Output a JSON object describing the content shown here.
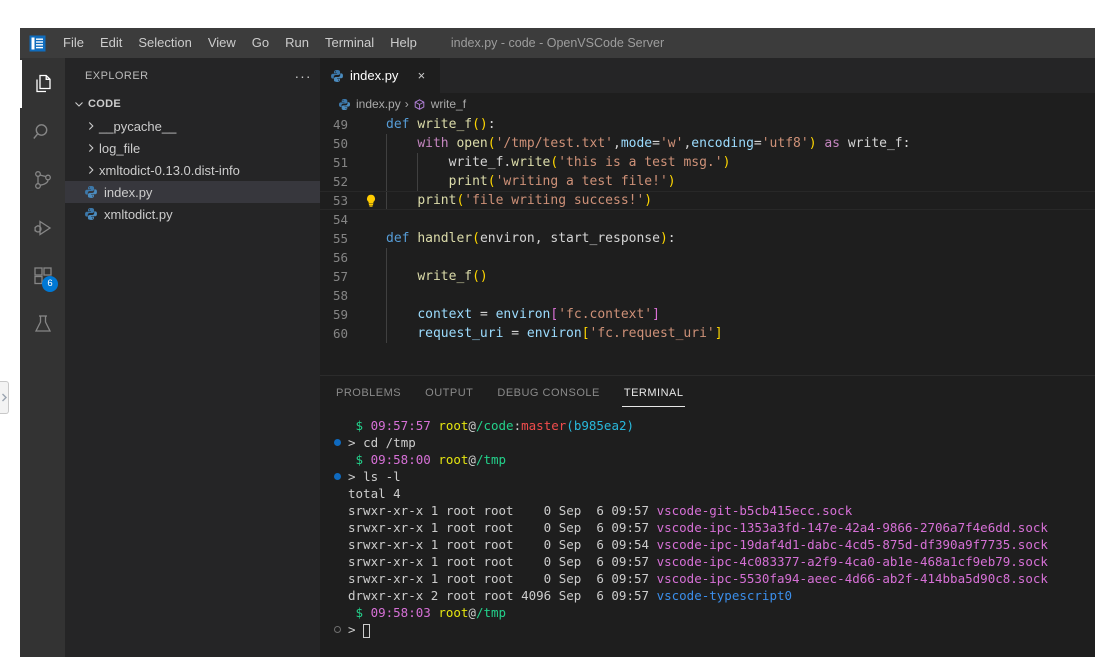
{
  "window": {
    "title": "index.py - code - OpenVSCode Server",
    "logo_icon": "vscode-logo-icon"
  },
  "menubar": {
    "items": [
      {
        "label": "File",
        "name": "menu-file"
      },
      {
        "label": "Edit",
        "name": "menu-edit"
      },
      {
        "label": "Selection",
        "name": "menu-selection"
      },
      {
        "label": "View",
        "name": "menu-view"
      },
      {
        "label": "Go",
        "name": "menu-go"
      },
      {
        "label": "Run",
        "name": "menu-run"
      },
      {
        "label": "Terminal",
        "name": "menu-terminal"
      },
      {
        "label": "Help",
        "name": "menu-help"
      }
    ]
  },
  "activitybar": {
    "items": [
      {
        "icon": "files-explorer-icon",
        "name": "activity-explorer",
        "active": true,
        "badge": ""
      },
      {
        "icon": "search-icon",
        "name": "activity-search",
        "active": false,
        "badge": ""
      },
      {
        "icon": "source-control-icon",
        "name": "activity-source-control",
        "active": false,
        "badge": ""
      },
      {
        "icon": "run-and-debug-icon",
        "name": "activity-run-debug",
        "active": false,
        "badge": ""
      },
      {
        "icon": "extensions-icon",
        "name": "activity-extensions",
        "active": false,
        "badge": "6"
      },
      {
        "icon": "testing-flask-icon",
        "name": "activity-testing",
        "active": false,
        "badge": ""
      }
    ],
    "badge_color": "#0078d4"
  },
  "sidebar": {
    "header_title": "EXPLORER",
    "more_actions": "···",
    "section_title": "CODE",
    "items": [
      {
        "label": "__pycache__",
        "type": "folder",
        "selected": false
      },
      {
        "label": "log_file",
        "type": "folder",
        "selected": false
      },
      {
        "label": "xmltodict-0.13.0.dist-info",
        "type": "folder",
        "selected": false
      },
      {
        "label": "index.py",
        "type": "python-file",
        "selected": true
      },
      {
        "label": "xmltodict.py",
        "type": "python-file",
        "selected": false
      }
    ]
  },
  "editor": {
    "tab": {
      "label": "index.py",
      "icon": "python-file-icon",
      "close_icon": "×"
    },
    "breadcrumb": {
      "file": "index.py",
      "symbol": "write_f",
      "separator": "›",
      "file_icon": "python-file-icon",
      "symbol_icon": "symbol-method-icon"
    },
    "lines": [
      {
        "num": "49",
        "bulb": false,
        "indent": 0,
        "tokens": [
          {
            "t": "def ",
            "c": "tok-kw"
          },
          {
            "t": "write_f",
            "c": "tok-fn"
          },
          {
            "t": "()",
            "c": "tok-paren"
          },
          {
            "t": ":",
            "c": "tok-plain"
          }
        ]
      },
      {
        "num": "50",
        "bulb": false,
        "indent": 1,
        "tokens": [
          {
            "t": "    ",
            "c": "tok-plain"
          },
          {
            "t": "with ",
            "c": "tok-kw2"
          },
          {
            "t": "open",
            "c": "tok-fn"
          },
          {
            "t": "(",
            "c": "tok-paren"
          },
          {
            "t": "'/tmp/test.txt'",
            "c": "tok-str"
          },
          {
            "t": ",",
            "c": "tok-plain"
          },
          {
            "t": "mode",
            "c": "tok-var"
          },
          {
            "t": "=",
            "c": "tok-plain"
          },
          {
            "t": "'w'",
            "c": "tok-str"
          },
          {
            "t": ",",
            "c": "tok-plain"
          },
          {
            "t": "encoding",
            "c": "tok-var"
          },
          {
            "t": "=",
            "c": "tok-plain"
          },
          {
            "t": "'utf8'",
            "c": "tok-str"
          },
          {
            "t": ")",
            "c": "tok-paren"
          },
          {
            "t": " ",
            "c": "tok-plain"
          },
          {
            "t": "as",
            "c": "tok-kw2"
          },
          {
            "t": " write_f:",
            "c": "tok-plain"
          }
        ]
      },
      {
        "num": "51",
        "bulb": false,
        "indent": 2,
        "tokens": [
          {
            "t": "        ",
            "c": "tok-plain"
          },
          {
            "t": "write_f",
            "c": "tok-plain"
          },
          {
            "t": ".",
            "c": "tok-plain"
          },
          {
            "t": "write",
            "c": "tok-fn"
          },
          {
            "t": "(",
            "c": "tok-paren"
          },
          {
            "t": "'this is a test msg.'",
            "c": "tok-str"
          },
          {
            "t": ")",
            "c": "tok-paren"
          }
        ]
      },
      {
        "num": "52",
        "bulb": false,
        "indent": 2,
        "tokens": [
          {
            "t": "        ",
            "c": "tok-plain"
          },
          {
            "t": "print",
            "c": "tok-fn"
          },
          {
            "t": "(",
            "c": "tok-paren"
          },
          {
            "t": "'writing a test file!'",
            "c": "tok-str"
          },
          {
            "t": ")",
            "c": "tok-paren"
          }
        ]
      },
      {
        "num": "53",
        "bulb": true,
        "indent": 1,
        "current": true,
        "tokens": [
          {
            "t": "    ",
            "c": "tok-plain"
          },
          {
            "t": "print",
            "c": "tok-fn"
          },
          {
            "t": "(",
            "c": "tok-paren"
          },
          {
            "t": "'file writing success!'",
            "c": "tok-str"
          },
          {
            "t": ")",
            "c": "tok-paren"
          }
        ]
      },
      {
        "num": "54",
        "bulb": false,
        "indent": 0,
        "tokens": []
      },
      {
        "num": "55",
        "bulb": false,
        "indent": 0,
        "tokens": [
          {
            "t": "def ",
            "c": "tok-kw"
          },
          {
            "t": "handler",
            "c": "tok-fn"
          },
          {
            "t": "(",
            "c": "tok-paren"
          },
          {
            "t": "environ, start_response",
            "c": "tok-plain"
          },
          {
            "t": ")",
            "c": "tok-paren"
          },
          {
            "t": ":",
            "c": "tok-plain"
          }
        ]
      },
      {
        "num": "56",
        "bulb": false,
        "indent": 1,
        "tokens": []
      },
      {
        "num": "57",
        "bulb": false,
        "indent": 1,
        "tokens": [
          {
            "t": "    ",
            "c": "tok-plain"
          },
          {
            "t": "write_f",
            "c": "tok-fn"
          },
          {
            "t": "()",
            "c": "tok-paren"
          }
        ]
      },
      {
        "num": "58",
        "bulb": false,
        "indent": 1,
        "tokens": []
      },
      {
        "num": "59",
        "bulb": false,
        "indent": 1,
        "tokens": [
          {
            "t": "    ",
            "c": "tok-plain"
          },
          {
            "t": "context ",
            "c": "tok-var"
          },
          {
            "t": "= ",
            "c": "tok-plain"
          },
          {
            "t": "environ",
            "c": "tok-var"
          },
          {
            "t": "[",
            "c": "tok-brack"
          },
          {
            "t": "'fc.context'",
            "c": "tok-str"
          },
          {
            "t": "]",
            "c": "tok-brack"
          }
        ]
      },
      {
        "num": "60",
        "bulb": false,
        "indent": 1,
        "tokens": [
          {
            "t": "    ",
            "c": "tok-plain"
          },
          {
            "t": "request_uri ",
            "c": "tok-var"
          },
          {
            "t": "= ",
            "c": "tok-plain"
          },
          {
            "t": "environ",
            "c": "tok-var"
          },
          {
            "t": "[",
            "c": "tok-paren"
          },
          {
            "t": "'fc.request_uri'",
            "c": "tok-str"
          },
          {
            "t": "]",
            "c": "tok-paren"
          }
        ]
      }
    ]
  },
  "panel": {
    "tabs": [
      {
        "label": "PROBLEMS",
        "active": false
      },
      {
        "label": "OUTPUT",
        "active": false
      },
      {
        "label": "DEBUG CONSOLE",
        "active": false
      },
      {
        "label": "TERMINAL",
        "active": true
      }
    ]
  },
  "terminal": {
    "rows": [
      {
        "deco": "none",
        "parts": [
          {
            "t": " $ ",
            "c": "c-green"
          },
          {
            "t": "09:57:57 ",
            "c": "c-magenta"
          },
          {
            "t": "root",
            "c": "c-yellow"
          },
          {
            "t": "@",
            "c": "c-white"
          },
          {
            "t": "/code",
            "c": "c-green"
          },
          {
            "t": ":",
            "c": "c-white"
          },
          {
            "t": "master",
            "c": "c-red"
          },
          {
            "t": "(",
            "c": "c-cyan"
          },
          {
            "t": "b985ea2",
            "c": "c-cyan"
          },
          {
            "t": ")",
            "c": "c-cyan"
          }
        ]
      },
      {
        "deco": "dot",
        "parts": [
          {
            "t": "> ",
            "c": "c-white"
          },
          {
            "t": "cd /tmp",
            "c": "c-white"
          }
        ]
      },
      {
        "deco": "none",
        "parts": [
          {
            "t": " $ ",
            "c": "c-green"
          },
          {
            "t": "09:58:00 ",
            "c": "c-magenta"
          },
          {
            "t": "root",
            "c": "c-yellow"
          },
          {
            "t": "@",
            "c": "c-white"
          },
          {
            "t": "/tmp",
            "c": "c-green"
          }
        ]
      },
      {
        "deco": "dot",
        "parts": [
          {
            "t": "> ",
            "c": "c-white"
          },
          {
            "t": "ls -l",
            "c": "c-white"
          }
        ]
      },
      {
        "deco": "none",
        "parts": [
          {
            "t": "total 4",
            "c": "c-white"
          }
        ]
      },
      {
        "deco": "none",
        "parts": [
          {
            "t": "srwxr-xr-x 1 root root    0 Sep  6 09:57 ",
            "c": "c-white"
          },
          {
            "t": "vscode-git-b5cb415ecc.sock",
            "c": "c-magenta"
          }
        ]
      },
      {
        "deco": "none",
        "parts": [
          {
            "t": "srwxr-xr-x 1 root root    0 Sep  6 09:57 ",
            "c": "c-white"
          },
          {
            "t": "vscode-ipc-1353a3fd-147e-42a4-9866-2706a7f4e6dd.sock",
            "c": "c-magenta"
          }
        ]
      },
      {
        "deco": "none",
        "parts": [
          {
            "t": "srwxr-xr-x 1 root root    0 Sep  6 09:54 ",
            "c": "c-white"
          },
          {
            "t": "vscode-ipc-19daf4d1-dabc-4cd5-875d-df390a9f7735.sock",
            "c": "c-magenta"
          }
        ]
      },
      {
        "deco": "none",
        "parts": [
          {
            "t": "srwxr-xr-x 1 root root    0 Sep  6 09:57 ",
            "c": "c-white"
          },
          {
            "t": "vscode-ipc-4c083377-a2f9-4ca0-ab1e-468a1cf9eb79.sock",
            "c": "c-magenta"
          }
        ]
      },
      {
        "deco": "none",
        "parts": [
          {
            "t": "srwxr-xr-x 1 root root    0 Sep  6 09:57 ",
            "c": "c-white"
          },
          {
            "t": "vscode-ipc-5530fa94-aeec-4d66-ab2f-414bba5d90c8.sock",
            "c": "c-magenta"
          }
        ]
      },
      {
        "deco": "none",
        "parts": [
          {
            "t": "drwxr-xr-x 2 root root 4096 Sep  6 09:57 ",
            "c": "c-white"
          },
          {
            "t": "vscode-typescript0",
            "c": "c-blue"
          }
        ]
      },
      {
        "deco": "none",
        "parts": [
          {
            "t": " $ ",
            "c": "c-green"
          },
          {
            "t": "09:58:03 ",
            "c": "c-magenta"
          },
          {
            "t": "root",
            "c": "c-yellow"
          },
          {
            "t": "@",
            "c": "c-white"
          },
          {
            "t": "/tmp",
            "c": "c-green"
          }
        ]
      },
      {
        "deco": "hollow",
        "cursor": true,
        "parts": [
          {
            "t": "> ",
            "c": "c-white"
          }
        ]
      }
    ]
  }
}
